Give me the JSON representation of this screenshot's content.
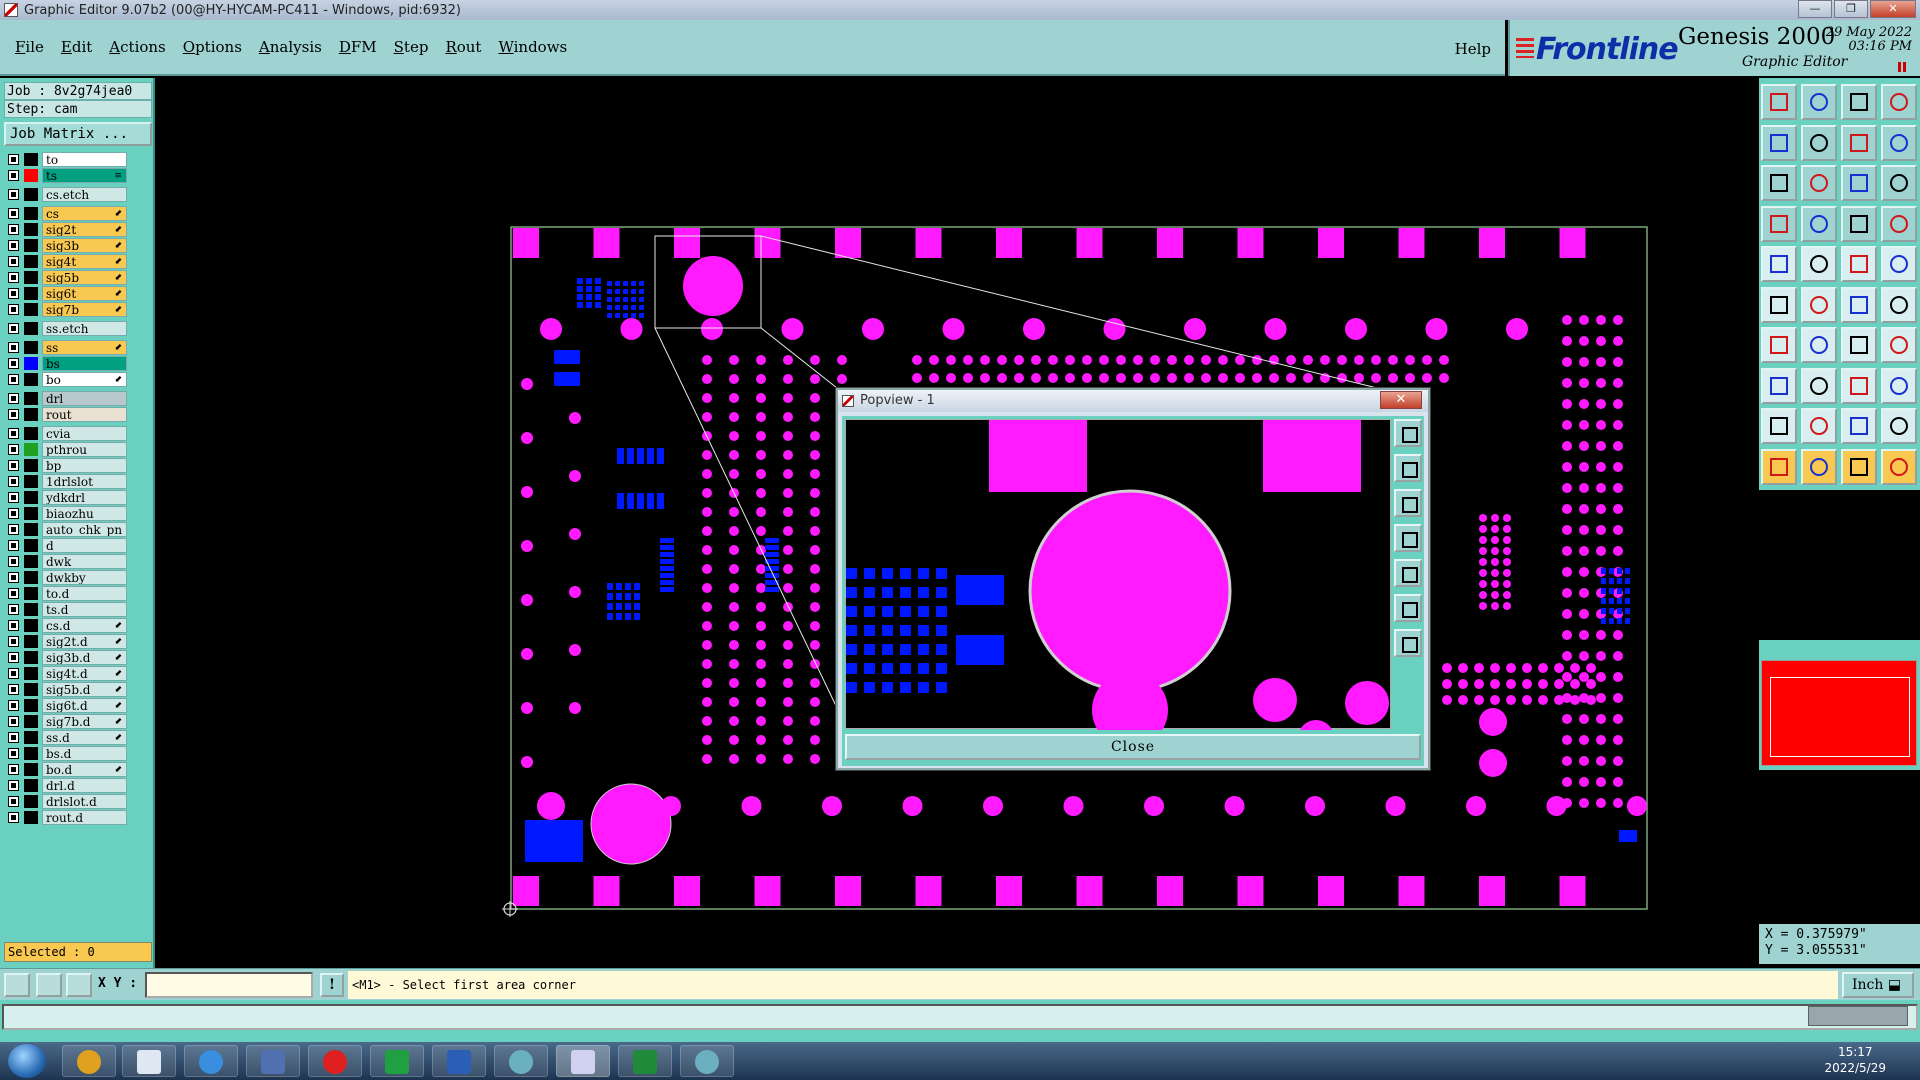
{
  "window": {
    "title": "Graphic Editor 9.07b2 (00@HY-HYCAM-PC411 - Windows, pid:6932)",
    "min_glyph": "—",
    "max_glyph": "❐",
    "close_glyph": "✕"
  },
  "menu": {
    "items": [
      "File",
      "Edit",
      "Actions",
      "Options",
      "Analysis",
      "DFM",
      "Step",
      "Rout",
      "Windows"
    ],
    "help": "Help"
  },
  "brand": {
    "logo": "Frontline",
    "product": "Genesis 2000",
    "subtitle": "Graphic Editor",
    "date": "29 May 2022",
    "time": "03:16 PM"
  },
  "job": {
    "job_label": "Job : 8v2g74jea0",
    "step_label": "Step: cam",
    "matrix_button": "Job Matrix ..."
  },
  "layers": [
    {
      "name": "to",
      "color": "#000000",
      "bg": "#ffffff",
      "flag": ""
    },
    {
      "name": "ts",
      "color": "#ff0000",
      "bg": "#00a080",
      "flag": "≡"
    },
    {
      "name": "cs.etch",
      "color": "#000000",
      "bg": "#cfe8e6",
      "flag": ""
    },
    {
      "name": "cs",
      "color": "#000000",
      "bg": "#f8c850",
      "flag": "⬋"
    },
    {
      "name": "sig2t",
      "color": "#000000",
      "bg": "#f8c850",
      "flag": "⬋"
    },
    {
      "name": "sig3b",
      "color": "#000000",
      "bg": "#f8c850",
      "flag": "⬋"
    },
    {
      "name": "sig4t",
      "color": "#000000",
      "bg": "#f8c850",
      "flag": "⬋"
    },
    {
      "name": "sig5b",
      "color": "#000000",
      "bg": "#f8c850",
      "flag": "⬋"
    },
    {
      "name": "sig6t",
      "color": "#000000",
      "bg": "#f8c850",
      "flag": "⬋"
    },
    {
      "name": "sig7b",
      "color": "#000000",
      "bg": "#f8c850",
      "flag": "⬋"
    },
    {
      "name": "ss.etch",
      "color": "#000000",
      "bg": "#cfe8e6",
      "flag": ""
    },
    {
      "name": "ss",
      "color": "#000000",
      "bg": "#f8c850",
      "flag": "⬋"
    },
    {
      "name": "bs",
      "color": "#0000ff",
      "bg": "#00a080",
      "flag": ""
    },
    {
      "name": "bo",
      "color": "#000000",
      "bg": "#ffffff",
      "flag": "⬋"
    },
    {
      "name": "drl",
      "color": "#000000",
      "bg": "#b8c8cc",
      "flag": ""
    },
    {
      "name": "rout",
      "color": "#000000",
      "bg": "#e8e0d0",
      "flag": ""
    },
    {
      "name": "cvia",
      "color": "#000000",
      "bg": "#cfe8e6",
      "flag": ""
    },
    {
      "name": "pthrou",
      "color": "#20a020",
      "bg": "#cfe8e6",
      "flag": ""
    },
    {
      "name": "bp",
      "color": "#000000",
      "bg": "#cfe8e6",
      "flag": ""
    },
    {
      "name": "1drlslot",
      "color": "#000000",
      "bg": "#cfe8e6",
      "flag": ""
    },
    {
      "name": "ydkdrl",
      "color": "#000000",
      "bg": "#cfe8e6",
      "flag": ""
    },
    {
      "name": "biaozhu",
      "color": "#000000",
      "bg": "#cfe8e6",
      "flag": ""
    },
    {
      "name": "auto_chk_pn",
      "color": "#000000",
      "bg": "#cfe8e6",
      "flag": ""
    },
    {
      "name": "d",
      "color": "#000000",
      "bg": "#cfe8e6",
      "flag": ""
    },
    {
      "name": "dwk",
      "color": "#000000",
      "bg": "#cfe8e6",
      "flag": ""
    },
    {
      "name": "dwkby",
      "color": "#000000",
      "bg": "#cfe8e6",
      "flag": ""
    },
    {
      "name": "to.d",
      "color": "#000000",
      "bg": "#cfe8e6",
      "flag": ""
    },
    {
      "name": "ts.d",
      "color": "#000000",
      "bg": "#cfe8e6",
      "flag": ""
    },
    {
      "name": "cs.d",
      "color": "#000000",
      "bg": "#cfe8e6",
      "flag": "⬋"
    },
    {
      "name": "sig2t.d",
      "color": "#000000",
      "bg": "#cfe8e6",
      "flag": "⬋"
    },
    {
      "name": "sig3b.d",
      "color": "#000000",
      "bg": "#cfe8e6",
      "flag": "⬋"
    },
    {
      "name": "sig4t.d",
      "color": "#000000",
      "bg": "#cfe8e6",
      "flag": "⬋"
    },
    {
      "name": "sig5b.d",
      "color": "#000000",
      "bg": "#cfe8e6",
      "flag": "⬋"
    },
    {
      "name": "sig6t.d",
      "color": "#000000",
      "bg": "#cfe8e6",
      "flag": "⬋"
    },
    {
      "name": "sig7b.d",
      "color": "#000000",
      "bg": "#cfe8e6",
      "flag": "⬋"
    },
    {
      "name": "ss.d",
      "color": "#000000",
      "bg": "#cfe8e6",
      "flag": "⬋"
    },
    {
      "name": "bs.d",
      "color": "#000000",
      "bg": "#cfe8e6",
      "flag": ""
    },
    {
      "name": "bo.d",
      "color": "#000000",
      "bg": "#cfe8e6",
      "flag": "⬋"
    },
    {
      "name": "drl.d",
      "color": "#000000",
      "bg": "#cfe8e6",
      "flag": ""
    },
    {
      "name": "drlslot.d",
      "color": "#000000",
      "bg": "#cfe8e6",
      "flag": ""
    },
    {
      "name": "rout.d",
      "color": "#000000",
      "bg": "#cfe8e6",
      "flag": ""
    }
  ],
  "selected_label": "Selected : 0",
  "popview": {
    "title": "Popview - 1",
    "close_glyph": "✕",
    "close_button": "Close"
  },
  "coords": {
    "x": "X = 0.375979\"",
    "y": "Y = 3.055531\""
  },
  "command": {
    "xy_label": "X Y :",
    "xy_value": "",
    "warn_glyph": "!",
    "prompt": "<M1> - Select first area corner",
    "units": "Inch ⬓"
  },
  "taskbar": {
    "time": "15:17",
    "date": "2022/5/29"
  },
  "colors": {
    "pad": "#ff1aff",
    "smd": "#0018ff",
    "panel": "#6ad0c0",
    "menu": "#9ed3d1"
  }
}
